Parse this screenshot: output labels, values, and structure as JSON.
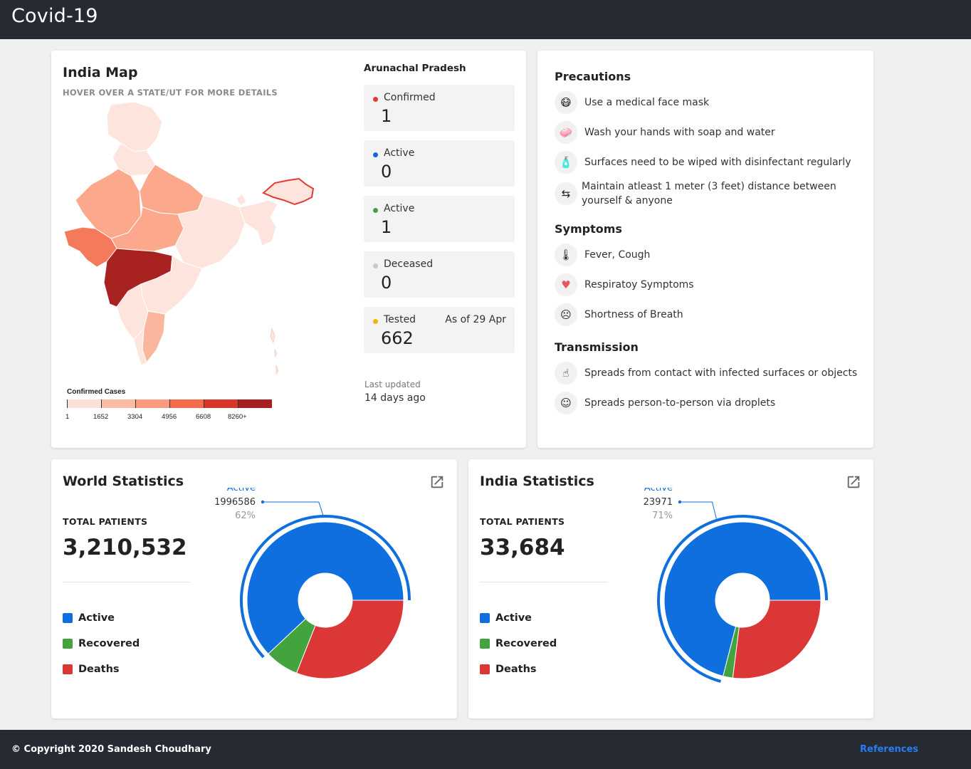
{
  "app": {
    "title": "Covid-19"
  },
  "map_card": {
    "title": "India Map",
    "subtitle": "HOVER OVER A STATE/UT FOR MORE DETAILS",
    "legend": {
      "title": "Confirmed Cases",
      "ticks": [
        "1",
        "1652",
        "3304",
        "4956",
        "6608",
        "8260+"
      ],
      "colors": [
        "#fde0d7",
        "#fcbca3",
        "#fb9a7d",
        "#f66b4b",
        "#d9352a",
        "#a51f1f"
      ]
    }
  },
  "state_panel": {
    "state": "Arunachal Pradesh",
    "stats": [
      {
        "label": "Confirmed",
        "value": "1",
        "color": "#e53935"
      },
      {
        "label": "Active",
        "value": "0",
        "color": "#1565e0"
      },
      {
        "label": "Active",
        "value": "1",
        "color": "#43a047"
      },
      {
        "label": "Deceased",
        "value": "0",
        "color": "#c8c8c8"
      },
      {
        "label": "Tested",
        "value": "662",
        "color": "#f4b400",
        "as_of": "As of 29 Apr"
      }
    ],
    "last_updated_label": "Last updated",
    "last_updated_value": "14 days ago"
  },
  "info_card": {
    "precautions_title": "Precautions",
    "precautions": [
      {
        "icon": "face-mask-icon",
        "text": "Use a medical face mask"
      },
      {
        "icon": "hand-wash-icon",
        "text": "Wash your hands with soap and water"
      },
      {
        "icon": "disinfect-icon",
        "text": "Surfaces need to be wiped with disinfectant regularly"
      },
      {
        "icon": "distance-icon",
        "text": "Maintain atleast 1 meter (3 feet) distance between yourself & anyone"
      }
    ],
    "symptoms_title": "Symptoms",
    "symptoms": [
      {
        "icon": "thermometer-icon",
        "text": "Fever, Cough"
      },
      {
        "icon": "lungs-icon",
        "text": "Respiratoy Symptoms"
      },
      {
        "icon": "breath-icon",
        "text": "Shortness of Breath"
      }
    ],
    "transmission_title": "Transmission",
    "transmission": [
      {
        "icon": "fingerprint-icon",
        "text": "Spreads from contact with infected surfaces or objects"
      },
      {
        "icon": "sneeze-icon",
        "text": "Spreads person-to-person via droplets"
      }
    ]
  },
  "world": {
    "title": "World Statistics",
    "total_label": "TOTAL PATIENTS",
    "total_value": "3,210,532",
    "legend": [
      {
        "label": "Active",
        "color": "#0f6fde"
      },
      {
        "label": "Recovered",
        "color": "#43a33f"
      },
      {
        "label": "Deaths",
        "color": "#dc3737"
      }
    ],
    "callout": {
      "label": "Active",
      "value": "1996586",
      "percent": "62%"
    }
  },
  "india": {
    "title": "India Statistics",
    "total_label": "TOTAL PATIENTS",
    "total_value": "33,684",
    "legend": [
      {
        "label": "Active",
        "color": "#0f6fde"
      },
      {
        "label": "Recovered",
        "color": "#43a33f"
      },
      {
        "label": "Deaths",
        "color": "#dc3737"
      }
    ],
    "callout": {
      "label": "Active",
      "value": "23971",
      "percent": "71%"
    }
  },
  "chart_data": [
    {
      "type": "pie",
      "categories": [
        "Active",
        "Recovered",
        "Deaths"
      ],
      "values": [
        62,
        7,
        31
      ],
      "unit": "percent",
      "highlighted": "Active"
    },
    {
      "type": "pie",
      "categories": [
        "Active",
        "Recovered",
        "Deaths"
      ],
      "values": [
        71,
        2,
        27
      ],
      "unit": "percent",
      "highlighted": "Active"
    }
  ],
  "footer": {
    "copyright": "© Copyright 2020 Sandesh Choudhary",
    "references": "References"
  }
}
